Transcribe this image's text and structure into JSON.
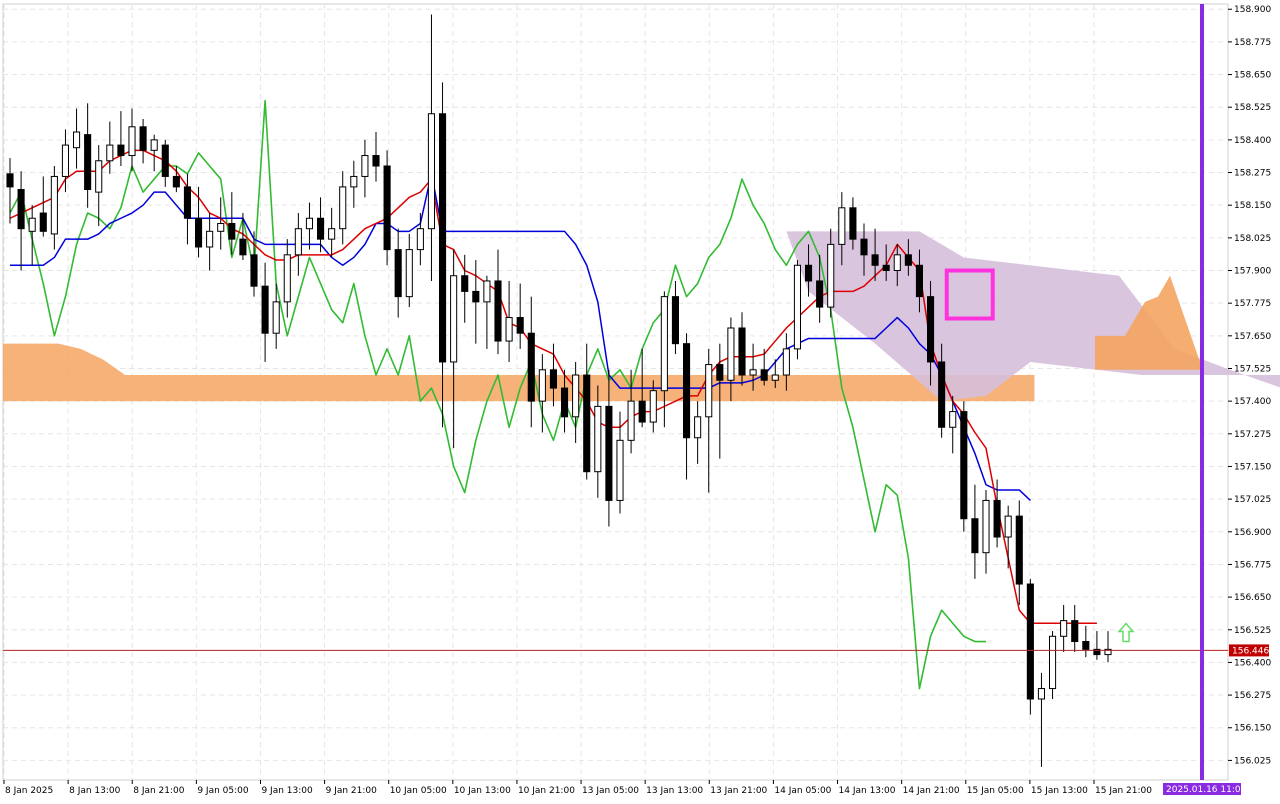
{
  "chart_data": {
    "type": "candlestick",
    "price_axis": {
      "ticks": [
        "158.900",
        "158.775",
        "158.650",
        "158.525",
        "158.400",
        "158.275",
        "158.150",
        "158.025",
        "157.900",
        "157.775",
        "157.650",
        "157.525",
        "157.400",
        "157.275",
        "157.150",
        "157.025",
        "156.900",
        "156.775",
        "156.650",
        "156.525",
        "156.400",
        "156.275",
        "156.150",
        "156.025"
      ],
      "range": [
        155.95,
        158.92
      ]
    },
    "time_axis": {
      "labels": [
        "8 Jan 2025",
        "8 Jan 13:00",
        "8 Jan 21:00",
        "9 Jan 05:00",
        "9 Jan 13:00",
        "9 Jan 21:00",
        "10 Jan 05:00",
        "10 Jan 13:00",
        "10 Jan 21:00",
        "13 Jan 05:00",
        "13 Jan 13:00",
        "13 Jan 21:00",
        "14 Jan 05:00",
        "14 Jan 13:00",
        "14 Jan 21:00",
        "15 Jan 05:00",
        "15 Jan 13:00",
        "15 Jan 21:00"
      ]
    },
    "current_price": "156.446",
    "future_time_marker": "2025.01.16 11:00",
    "colors": {
      "grid": "#e6e6e6",
      "tenkan": "#dd0000",
      "kijun": "#0000dd",
      "chikou": "#33bb33",
      "senkou_bullish_cloud": "#f4a460",
      "senkou_bearish_cloud": "#d6bfdc",
      "price_line": "#b22222",
      "price_badge": "#c00000",
      "time_badge": "#8a2be2",
      "marker_box": "#ff33dd",
      "arrow": "#66dd66",
      "bull_candle": "#ffffff",
      "bear_candle": "#000000"
    },
    "candles": [
      [
        158.27,
        158.33,
        158.08,
        158.22
      ],
      [
        158.21,
        158.28,
        157.9,
        158.06
      ],
      [
        158.05,
        158.15,
        157.92,
        158.1
      ],
      [
        158.12,
        158.26,
        158.03,
        158.05
      ],
      [
        158.04,
        158.3,
        157.98,
        158.26
      ],
      [
        158.26,
        158.44,
        158.2,
        158.38
      ],
      [
        158.37,
        158.52,
        158.29,
        158.43
      ],
      [
        158.42,
        158.54,
        158.14,
        158.21
      ],
      [
        158.2,
        158.38,
        158.07,
        158.32
      ],
      [
        158.32,
        158.47,
        158.27,
        158.38
      ],
      [
        158.38,
        158.51,
        158.3,
        158.34
      ],
      [
        158.34,
        158.52,
        158.28,
        158.45
      ],
      [
        158.45,
        158.48,
        158.31,
        158.36
      ],
      [
        158.36,
        158.42,
        158.28,
        158.4
      ],
      [
        158.38,
        158.4,
        158.22,
        158.26
      ],
      [
        158.26,
        158.3,
        158.2,
        158.22
      ],
      [
        158.22,
        158.27,
        158.0,
        158.1
      ],
      [
        158.1,
        158.22,
        157.95,
        157.99
      ],
      [
        157.99,
        158.12,
        157.9,
        158.05
      ],
      [
        158.05,
        158.18,
        157.98,
        158.08
      ],
      [
        158.08,
        158.2,
        157.96,
        158.02
      ],
      [
        158.02,
        158.12,
        157.94,
        157.96
      ],
      [
        157.96,
        158.05,
        157.8,
        157.84
      ],
      [
        157.84,
        157.93,
        157.55,
        157.66
      ],
      [
        157.66,
        157.85,
        157.6,
        157.78
      ],
      [
        157.78,
        158.02,
        157.72,
        157.96
      ],
      [
        157.96,
        158.12,
        157.88,
        158.06
      ],
      [
        158.06,
        158.16,
        157.98,
        158.1
      ],
      [
        158.1,
        158.18,
        157.97,
        158.02
      ],
      [
        158.02,
        158.14,
        157.95,
        158.06
      ],
      [
        158.06,
        158.28,
        158.0,
        158.22
      ],
      [
        158.22,
        158.32,
        158.14,
        158.26
      ],
      [
        158.26,
        158.4,
        158.18,
        158.34
      ],
      [
        158.34,
        158.43,
        158.24,
        158.3
      ],
      [
        158.3,
        158.36,
        157.92,
        157.98
      ],
      [
        157.98,
        158.06,
        157.72,
        157.8
      ],
      [
        157.8,
        158.04,
        157.76,
        157.98
      ],
      [
        157.98,
        158.12,
        157.92,
        158.06
      ],
      [
        158.06,
        158.88,
        157.86,
        158.5
      ],
      [
        158.5,
        158.62,
        157.3,
        157.55
      ],
      [
        157.55,
        157.98,
        157.22,
        157.88
      ],
      [
        157.88,
        157.96,
        157.7,
        157.82
      ],
      [
        157.82,
        157.94,
        157.62,
        157.78
      ],
      [
        157.78,
        157.88,
        157.6,
        157.86
      ],
      [
        157.86,
        157.98,
        157.58,
        157.63
      ],
      [
        157.63,
        157.86,
        157.55,
        157.72
      ],
      [
        157.72,
        157.85,
        157.6,
        157.66
      ],
      [
        157.66,
        157.8,
        157.3,
        157.4
      ],
      [
        157.4,
        157.58,
        157.28,
        157.52
      ],
      [
        157.52,
        157.62,
        157.38,
        157.45
      ],
      [
        157.45,
        157.52,
        157.28,
        157.34
      ],
      [
        157.34,
        157.55,
        157.24,
        157.5
      ],
      [
        157.5,
        157.62,
        157.1,
        157.13
      ],
      [
        157.13,
        157.46,
        157.03,
        157.38
      ],
      [
        157.38,
        157.52,
        156.92,
        157.02
      ],
      [
        157.02,
        157.36,
        156.97,
        157.25
      ],
      [
        157.25,
        157.52,
        157.2,
        157.4
      ],
      [
        157.4,
        157.6,
        157.3,
        157.32
      ],
      [
        157.32,
        157.48,
        157.28,
        157.44
      ],
      [
        157.44,
        157.82,
        157.3,
        157.8
      ],
      [
        157.8,
        157.86,
        157.58,
        157.62
      ],
      [
        157.62,
        157.66,
        157.1,
        157.26
      ],
      [
        157.26,
        157.4,
        157.16,
        157.34
      ],
      [
        157.34,
        157.6,
        157.05,
        157.54
      ],
      [
        157.54,
        157.62,
        157.18,
        157.48
      ],
      [
        157.48,
        157.72,
        157.4,
        157.68
      ],
      [
        157.68,
        157.74,
        157.46,
        157.5
      ],
      [
        157.5,
        157.62,
        157.44,
        157.52
      ],
      [
        157.52,
        157.6,
        157.46,
        157.48
      ],
      [
        157.48,
        157.56,
        157.45,
        157.5
      ],
      [
        157.5,
        157.66,
        157.44,
        157.6
      ],
      [
        157.6,
        157.94,
        157.56,
        157.92
      ],
      [
        157.92,
        158.0,
        157.8,
        157.86
      ],
      [
        157.86,
        157.96,
        157.7,
        157.76
      ],
      [
        157.76,
        158.06,
        157.72,
        158.0
      ],
      [
        158.0,
        158.2,
        157.92,
        158.14
      ],
      [
        158.14,
        158.18,
        157.98,
        158.02
      ],
      [
        158.02,
        158.08,
        157.88,
        157.96
      ],
      [
        157.96,
        158.06,
        157.86,
        157.92
      ],
      [
        157.92,
        158.0,
        157.86,
        157.9
      ],
      [
        157.9,
        158.0,
        157.84,
        157.96
      ],
      [
        157.96,
        158.02,
        157.88,
        157.92
      ],
      [
        157.92,
        157.98,
        157.74,
        157.8
      ],
      [
        157.8,
        157.86,
        157.46,
        157.55
      ],
      [
        157.55,
        157.62,
        157.26,
        157.3
      ],
      [
        157.3,
        157.42,
        157.2,
        157.36
      ],
      [
        157.36,
        157.4,
        156.9,
        156.95
      ],
      [
        156.95,
        157.08,
        156.72,
        156.82
      ],
      [
        156.82,
        157.06,
        156.74,
        157.02
      ],
      [
        157.02,
        157.1,
        156.84,
        156.88
      ],
      [
        156.88,
        157.0,
        156.76,
        156.96
      ],
      [
        156.96,
        157.02,
        156.62,
        156.7
      ],
      [
        156.7,
        156.72,
        156.2,
        156.26
      ],
      [
        156.26,
        156.36,
        156.0,
        156.3
      ],
      [
        156.3,
        156.52,
        156.26,
        156.5
      ],
      [
        156.5,
        156.62,
        156.44,
        156.56
      ],
      [
        156.56,
        156.62,
        156.44,
        156.48
      ],
      [
        156.48,
        156.54,
        156.42,
        156.45
      ],
      [
        156.45,
        156.52,
        156.41,
        156.43
      ],
      [
        156.43,
        156.52,
        156.4,
        156.45
      ]
    ],
    "tenkan": [
      158.1,
      158.12,
      158.14,
      158.16,
      158.18,
      158.25,
      158.28,
      158.28,
      158.28,
      158.32,
      158.34,
      158.36,
      158.36,
      158.34,
      158.32,
      158.28,
      158.22,
      158.18,
      158.12,
      158.1,
      158.06,
      158.04,
      158.0,
      157.96,
      157.94,
      157.94,
      157.96,
      157.96,
      157.96,
      157.96,
      157.98,
      158.02,
      158.06,
      158.08,
      158.1,
      158.14,
      158.18,
      158.2,
      158.25,
      158.0,
      157.98,
      157.9,
      157.88,
      157.85,
      157.82,
      157.7,
      157.68,
      157.62,
      157.6,
      157.58,
      157.5,
      157.45,
      157.4,
      157.32,
      157.3,
      157.3,
      157.34,
      157.36,
      157.36,
      157.38,
      157.4,
      157.42,
      157.42,
      157.5,
      157.55,
      157.57,
      157.57,
      157.57,
      157.58,
      157.63,
      157.68,
      157.72,
      157.76,
      157.8,
      157.82,
      157.82,
      157.82,
      157.84,
      157.88,
      157.92,
      158.0,
      157.95,
      157.9,
      157.62,
      157.5,
      157.4,
      157.35,
      157.28,
      157.22,
      157.0,
      156.8,
      156.6,
      156.55,
      156.55,
      156.55,
      156.55,
      156.55,
      156.55,
      156.55
    ],
    "kijun": [
      157.92,
      157.92,
      157.92,
      157.92,
      157.95,
      158.02,
      158.02,
      158.02,
      158.04,
      158.08,
      158.1,
      158.12,
      158.15,
      158.2,
      158.2,
      158.15,
      158.1,
      158.1,
      158.1,
      158.1,
      158.1,
      158.1,
      158.02,
      158.0,
      158.0,
      158.0,
      158.0,
      158.0,
      158.0,
      157.95,
      157.92,
      157.95,
      158.0,
      158.08,
      158.08,
      158.05,
      158.05,
      158.08,
      158.27,
      158.05,
      158.05,
      158.05,
      158.05,
      158.05,
      158.05,
      158.05,
      158.05,
      158.05,
      158.05,
      158.05,
      158.05,
      158.0,
      157.92,
      157.78,
      157.5,
      157.45,
      157.45,
      157.45,
      157.45,
      157.45,
      157.45,
      157.45,
      157.45,
      157.45,
      157.47,
      157.47,
      157.47,
      157.48,
      157.5,
      157.55,
      157.6,
      157.62,
      157.64,
      157.64,
      157.64,
      157.64,
      157.64,
      157.64,
      157.64,
      157.68,
      157.72,
      157.68,
      157.62,
      157.58,
      157.5,
      157.4,
      157.3,
      157.2,
      157.08,
      157.06,
      157.06,
      157.06,
      157.02
    ],
    "chikou": [
      158.12,
      158.2,
      158.02,
      157.85,
      157.65,
      157.8,
      158.0,
      158.12,
      158.1,
      158.06,
      158.14,
      158.3,
      158.2,
      158.25,
      158.3,
      158.3,
      158.27,
      158.35,
      158.3,
      158.25,
      157.95,
      158.1,
      157.9,
      158.55,
      157.85,
      157.65,
      157.8,
      157.95,
      157.85,
      157.75,
      157.7,
      157.85,
      157.65,
      157.5,
      157.6,
      157.5,
      157.65,
      157.4,
      157.45,
      157.35,
      157.15,
      157.05,
      157.25,
      157.4,
      157.5,
      157.3,
      157.45,
      157.55,
      157.35,
      157.25,
      157.4,
      157.3,
      157.5,
      157.6,
      157.48,
      157.52,
      157.45,
      157.6,
      157.7,
      157.75,
      157.92,
      157.8,
      157.85,
      157.95,
      158.0,
      158.1,
      158.25,
      158.15,
      158.08,
      157.98,
      157.92,
      158.0,
      158.05,
      157.95,
      157.75,
      157.45,
      157.3,
      157.1,
      156.9,
      157.08,
      157.04,
      156.8,
      156.3,
      156.5,
      156.6,
      156.55,
      156.5,
      156.48,
      156.48
    ],
    "senkou_a": [
      157.62,
      157.62,
      157.62,
      157.62,
      157.62,
      157.62,
      157.61,
      157.6,
      157.58,
      157.56,
      157.53,
      157.5,
      157.5,
      157.5,
      157.5,
      157.5,
      157.5,
      157.5,
      157.5,
      157.5,
      157.5,
      157.5,
      157.5,
      157.5,
      157.5,
      157.5,
      157.5,
      157.5,
      157.5,
      157.5,
      157.5,
      157.5,
      157.5,
      157.5,
      157.5,
      157.5,
      157.5,
      157.5,
      157.5,
      157.5,
      157.5,
      157.5,
      157.5,
      157.5,
      157.5,
      157.5,
      157.5,
      157.5,
      157.5,
      157.5,
      157.5,
      157.5,
      157.5,
      157.5,
      157.5,
      157.5,
      157.5,
      157.5,
      157.5,
      157.5,
      157.5,
      157.5,
      157.5,
      157.5,
      157.5,
      157.5,
      157.5,
      157.5,
      157.5,
      157.5,
      157.5,
      157.5,
      157.5,
      157.5,
      157.5,
      157.5,
      157.5,
      157.5,
      157.5,
      157.5,
      157.5,
      157.5,
      157.5,
      157.5,
      157.5,
      157.5,
      157.5,
      157.5,
      157.5,
      157.5,
      157.5,
      157.5,
      157.5,
      157.5
    ],
    "senkou_b": [
      157.4,
      157.4,
      157.4,
      157.4,
      157.4,
      157.4,
      157.4,
      157.4,
      157.4,
      157.4,
      157.4,
      157.4,
      157.4,
      157.4,
      157.4,
      157.4,
      157.4,
      157.4,
      157.4,
      157.4,
      157.4,
      157.4,
      157.4,
      157.4,
      157.4,
      157.4,
      157.4,
      157.4,
      157.4,
      157.4,
      157.4,
      157.4,
      157.4,
      157.4,
      157.4,
      157.4,
      157.4,
      157.4,
      157.4,
      157.4,
      157.4,
      157.4,
      157.4,
      157.4,
      157.4,
      157.4,
      157.4,
      157.4,
      157.4,
      157.4,
      157.4,
      157.4,
      157.4,
      157.4,
      157.4,
      157.4,
      157.4,
      157.4,
      157.4,
      157.4,
      157.4,
      157.4,
      157.4,
      157.4,
      157.4,
      157.4,
      157.4,
      157.4,
      157.4,
      157.4,
      157.4,
      157.4,
      157.4,
      157.4,
      157.4,
      157.4,
      157.4,
      157.4,
      157.4,
      157.4,
      157.4,
      157.4,
      157.4,
      157.4,
      157.4,
      157.4,
      157.4,
      157.4,
      157.4,
      157.4,
      157.4,
      157.4,
      157.4,
      157.4
    ]
  }
}
